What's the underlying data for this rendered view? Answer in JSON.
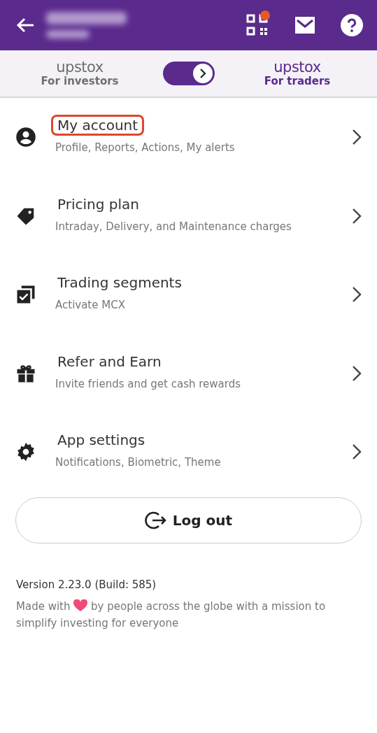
{
  "header": {
    "notification_dot": true
  },
  "switcher": {
    "on": true,
    "left": {
      "logo": "upstox",
      "label": "For investors",
      "selected": false
    },
    "right": {
      "logo": "upstox",
      "label": "For traders",
      "selected": true
    }
  },
  "menu": [
    {
      "kind": "account",
      "title": "My account",
      "subtitle": "Profile, Reports, Actions, My alerts",
      "highlighted": true
    },
    {
      "kind": "pricing",
      "title": "Pricing plan",
      "subtitle": "Intraday, Delivery, and Maintenance charges",
      "highlighted": false
    },
    {
      "kind": "segments",
      "title": "Trading segments",
      "subtitle": "Activate MCX",
      "highlighted": false
    },
    {
      "kind": "refer",
      "title": "Refer and Earn",
      "subtitle": "Invite friends and get cash rewards",
      "highlighted": false
    },
    {
      "kind": "settings",
      "title": "App settings",
      "subtitle": "Notifications, Biometric, Theme",
      "highlighted": false
    }
  ],
  "logout": "Log out",
  "footer": {
    "version": "Version 2.23.0 (Build: 585)",
    "tagline_before": "Made with",
    "tagline_after": "by people across the globe with a mission to",
    "tagline_line2": "simplify investing for everyone"
  }
}
